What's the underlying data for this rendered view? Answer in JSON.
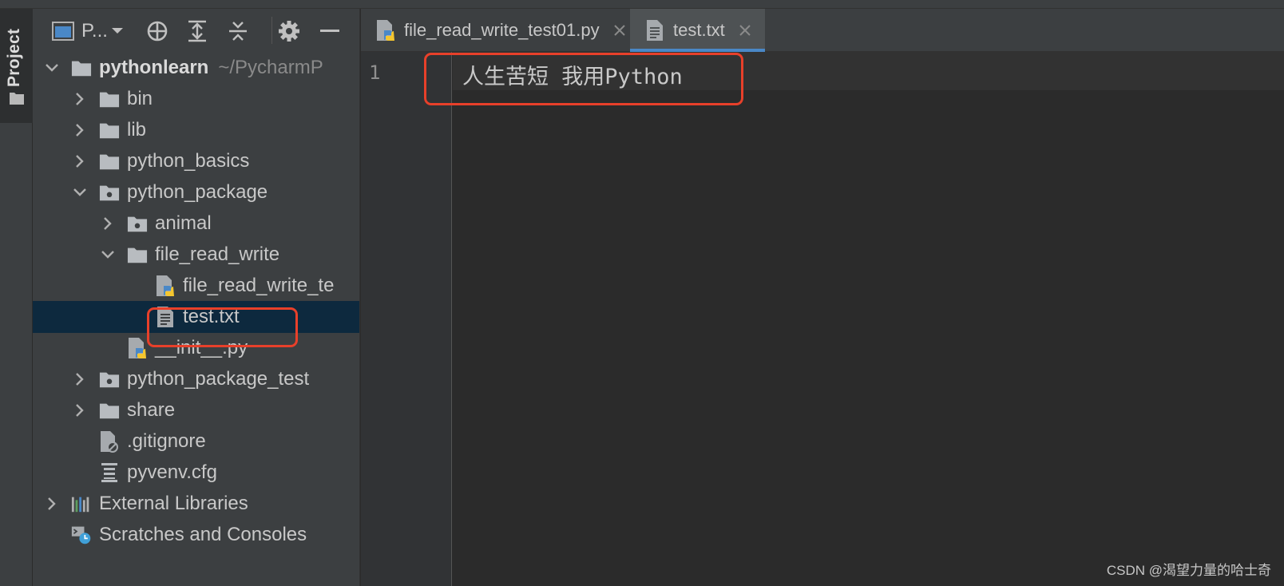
{
  "tool_strip": {
    "project_tab_label": "Project"
  },
  "project_panel": {
    "view_selector_label": "P...",
    "tree": [
      {
        "label": "pythonlearn",
        "path": "~/PycharmP",
        "expanded": true,
        "icon": "folder-icon"
      },
      {
        "label": "bin",
        "expanded": false,
        "icon": "folder-icon"
      },
      {
        "label": "lib",
        "expanded": false,
        "icon": "folder-icon"
      },
      {
        "label": "python_basics",
        "expanded": false,
        "icon": "folder-icon"
      },
      {
        "label": "python_package",
        "expanded": true,
        "icon": "package-folder-icon"
      },
      {
        "label": "animal",
        "expanded": false,
        "icon": "package-folder-icon"
      },
      {
        "label": "file_read_write",
        "expanded": true,
        "icon": "folder-icon"
      },
      {
        "label": "file_read_write_te",
        "icon": "python-file-icon"
      },
      {
        "label": "test.txt",
        "icon": "text-file-icon",
        "selected": true
      },
      {
        "label": "__init__.py",
        "icon": "python-file-icon"
      },
      {
        "label": "python_package_test",
        "expanded": false,
        "icon": "package-folder-icon"
      },
      {
        "label": "share",
        "expanded": false,
        "icon": "folder-icon"
      },
      {
        "label": ".gitignore",
        "icon": "gitignore-file-icon"
      },
      {
        "label": "pyvenv.cfg",
        "icon": "config-file-icon"
      },
      {
        "label": "External Libraries",
        "expanded": false,
        "icon": "libraries-icon"
      },
      {
        "label": "Scratches and Consoles",
        "icon": "scratches-icon"
      }
    ]
  },
  "editor": {
    "tabs": [
      {
        "label": "file_read_write_test01.py",
        "icon": "python-file-icon",
        "active": false
      },
      {
        "label": "test.txt",
        "icon": "text-file-icon",
        "active": true
      }
    ],
    "line_numbers": [
      "1"
    ],
    "content_line_1": "人生苦短 我用Python"
  },
  "colors": {
    "annotation": "#e8402a",
    "selection": "#0d293e",
    "tab_underline": "#4a88c7",
    "panel_bg": "#3c3f41",
    "editor_bg": "#2b2b2b"
  },
  "watermark": "CSDN @渴望力量的哈士奇"
}
